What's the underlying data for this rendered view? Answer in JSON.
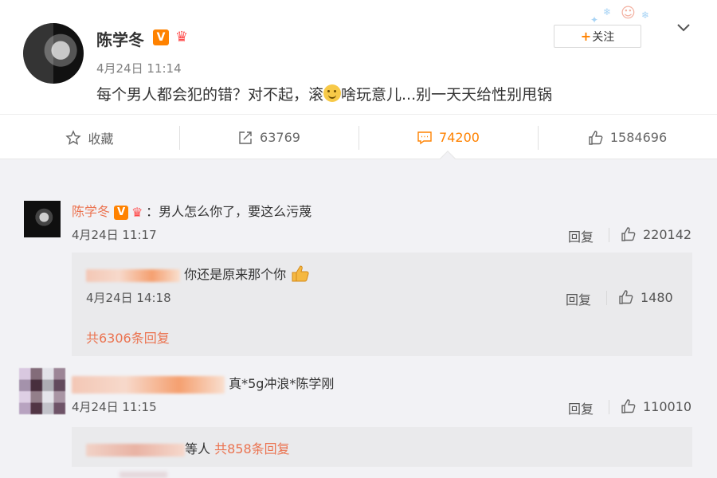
{
  "post": {
    "author": "陈学冬",
    "verified_badge": "V",
    "time": "4月24日 11:14",
    "text_before_emoji": "每个男人都会犯的错？对不起，滚",
    "text_after_emoji": "啥玩意儿...别一天天给性别甩锅",
    "follow_label": "关注",
    "follow_plus": "+"
  },
  "actions": {
    "favorite_label": "收藏",
    "repost_count": "63769",
    "comment_count": "74200",
    "like_count": "1584696"
  },
  "comments": [
    {
      "author": "陈学冬",
      "verified_badge": "V",
      "text": "：男人怎么你了，要这么污蔑",
      "time": "4月24日 11:17",
      "reply_label": "回复",
      "likes": "220142",
      "sub_reply": {
        "text": "你还是原来那个你",
        "time": "4月24日 14:18",
        "reply_label": "回复",
        "likes": "1480"
      },
      "more_replies": "共6306条回复"
    },
    {
      "text": "真*5g冲浪*陈学刚",
      "time": "4月24日 11:15",
      "reply_label": "回复",
      "likes": "110010",
      "sub_summary_suffix": "等人",
      "more_replies": "共858条回复"
    }
  ],
  "colors": {
    "accent": "#ff8200",
    "name_link": "#eb7350",
    "background": "#f2f2f5",
    "sub_box": "#eaeaec"
  },
  "icons": [
    "star-icon",
    "repost-icon",
    "comment-icon",
    "thumb-up-icon",
    "chevron-down-icon",
    "crown-icon",
    "verified-icon",
    "smile-emoji",
    "thumbs-up-emoji"
  ]
}
